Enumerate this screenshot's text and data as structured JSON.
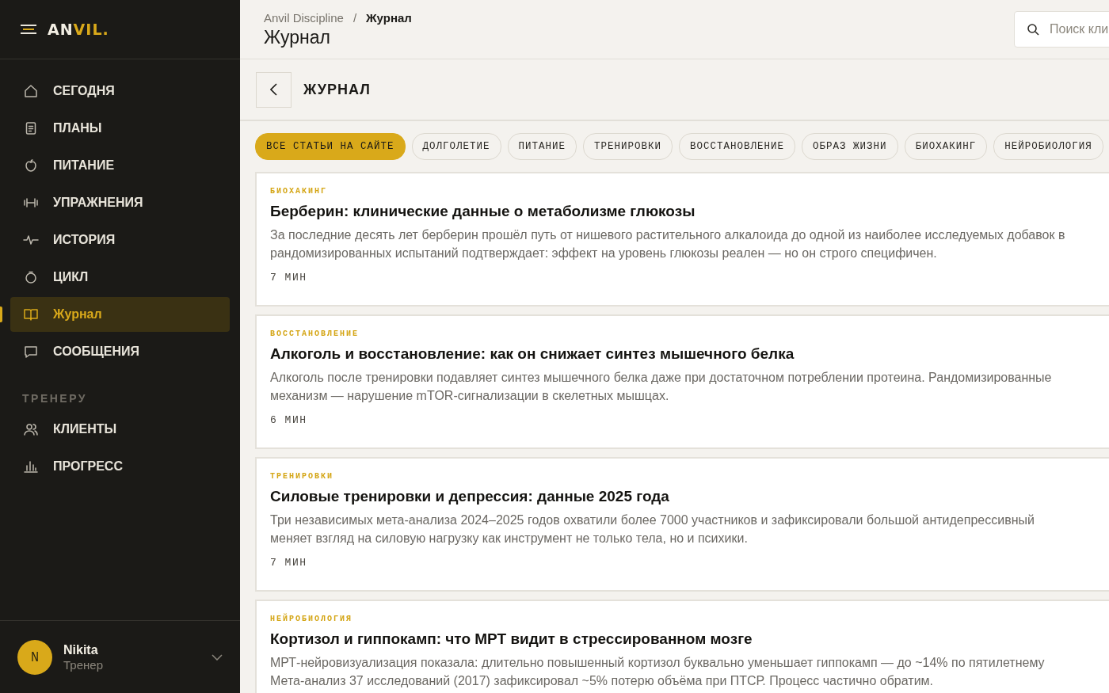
{
  "sidebar": {
    "logo": {
      "part_1": "AN",
      "part_2": "VIL."
    },
    "nav_items": [
      {
        "label": "СЕГОДНЯ",
        "selected": false
      },
      {
        "label": "ПЛАНЫ",
        "selected": false
      },
      {
        "label": "ПИТАНИЕ",
        "selected": false
      },
      {
        "label": "УПРАЖНЕНИЯ",
        "selected": false
      },
      {
        "label": "ИСТОРИЯ",
        "selected": false
      },
      {
        "label": "ЦИКЛ",
        "selected": false
      },
      {
        "label": "Журнал",
        "selected": true
      },
      {
        "label": "СООБЩЕНИЯ",
        "selected": false
      }
    ],
    "coach_section": {
      "title": "ТРЕНЕРУ",
      "items": [
        {
          "label": "КЛИЕНТЫ",
          "selected": false
        },
        {
          "label": "ПРОГРЕСС",
          "selected": false
        }
      ]
    },
    "user": {
      "initial": "N",
      "name": "Nikita",
      "role": "Тренер"
    }
  },
  "header": {
    "breadcrumbs": [
      "Anvil Discipline",
      "/",
      "Журнал"
    ],
    "title": "Журнал",
    "search": {
      "placeholder": "Поиск кли"
    }
  },
  "section": {
    "title": "ЖУРНАЛ"
  },
  "categories": [
    {
      "label": "ВСЕ СТАТЬИ НА САЙТЕ",
      "selected": true
    },
    {
      "label": "ДОЛГОЛЕТИЕ",
      "selected": false
    },
    {
      "label": "ПИТАНИЕ",
      "selected": false
    },
    {
      "label": "ТРЕНИРОВКИ",
      "selected": false
    },
    {
      "label": "ВОССТАНОВЛЕНИЕ",
      "selected": false
    },
    {
      "label": "ОБРАЗ ЖИЗНИ",
      "selected": false
    },
    {
      "label": "БИОХАКИНГ",
      "selected": false
    },
    {
      "label": "НЕЙРОБИОЛОГИЯ",
      "selected": false
    }
  ],
  "articles": [
    {
      "tag": "БИОХАКИНГ",
      "title": "Берберин: клинические данные о метаболизме глюкозы",
      "excerpt_lines": [
        "За последние десять лет берберин прошёл путь от нишевого растительного алкалоида до одной из наиболее исследуемых добавок в",
        "рандомизированных испытаний подтверждает: эффект на уровень глюкозы реален — но он строго специфичен."
      ],
      "read_time": "7 МИН"
    },
    {
      "tag": "ВОССТАНОВЛЕНИЕ",
      "title": "Алкоголь и восстановление: как он снижает синтез мышечного белка",
      "excerpt_lines": [
        "Алкоголь после тренировки подавляет синтез мышечного белка даже при достаточном потреблении протеина. Рандомизированные",
        "механизм — нарушение mTOR-сигнализации в скелетных мышцах."
      ],
      "read_time": "6 МИН"
    },
    {
      "tag": "ТРЕНИРОВКИ",
      "title": "Силовые тренировки и депрессия: данные 2025 года",
      "excerpt_lines": [
        "Три независимых мета-анализа 2024–2025 годов охватили более 7000 участников и зафиксировали большой антидепрессивный",
        "меняет взгляд на силовую нагрузку как инструмент не только тела, но и психики."
      ],
      "read_time": "7 МИН"
    },
    {
      "tag": "НЕЙРОБИОЛОГИЯ",
      "title": "Кортизол и гиппокамп: что МРТ видит в стрессированном мозге",
      "excerpt_lines": [
        "МРТ-нейровизуализация показала: длительно повышенный кортизол буквально уменьшает гиппокамп — до ~14% по пятилетнему",
        "Мета-анализ 37 исследований (2017) зафиксировал ~5% потерю объёма при ПТСР. Процесс частично обратим."
      ]
    }
  ]
}
